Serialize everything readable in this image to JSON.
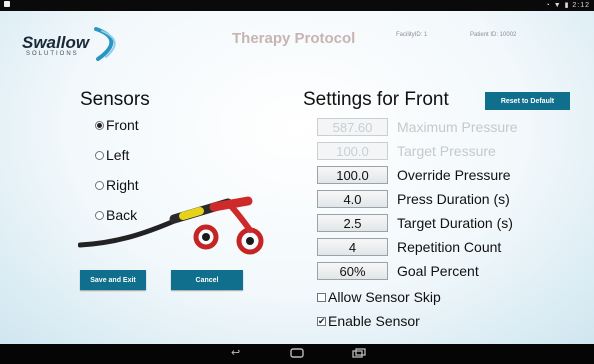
{
  "status_bar": {
    "right": "◔ ▼ ▮ 2:12"
  },
  "app": {
    "logo_word": "Swallow",
    "logo_sub": "SOLUTIONS",
    "title": "Therapy Protocol"
  },
  "header_ids": {
    "left": "FacilityID: 1",
    "right": "Patient ID: 10002"
  },
  "sensors": {
    "heading": "Sensors",
    "options": [
      {
        "label": "Front",
        "selected": true
      },
      {
        "label": "Left",
        "selected": false
      },
      {
        "label": "Right",
        "selected": false
      },
      {
        "label": "Back",
        "selected": false
      }
    ]
  },
  "buttons": {
    "save_exit": "Save and Exit",
    "cancel": "Cancel",
    "reset": "Reset to Default"
  },
  "settings": {
    "heading": "Settings for Front",
    "rows": [
      {
        "value": "587.60",
        "label": "Maximum Pressure",
        "enabled": false
      },
      {
        "value": "100.0",
        "label": "Target Pressure",
        "enabled": false
      },
      {
        "value": "100.0",
        "label": "Override Pressure",
        "enabled": true
      },
      {
        "value": "4.0",
        "label": "Press Duration (s)",
        "enabled": true
      },
      {
        "value": "2.5",
        "label": "Target Duration (s)",
        "enabled": true
      },
      {
        "value": "4",
        "label": "Repetition Count",
        "enabled": true
      },
      {
        "value": "60%",
        "label": "Goal Percent",
        "enabled": true
      }
    ],
    "checks": [
      {
        "label": "Allow Sensor Skip",
        "checked": false
      },
      {
        "label": "Enable Sensor",
        "checked": true
      }
    ]
  },
  "nav": {
    "back_icon": "back-arrow-icon",
    "home_icon": "home-icon",
    "recents_icon": "recents-icon"
  },
  "colors": {
    "accent": "#0f6f8c",
    "title": "#c7b4b3"
  }
}
